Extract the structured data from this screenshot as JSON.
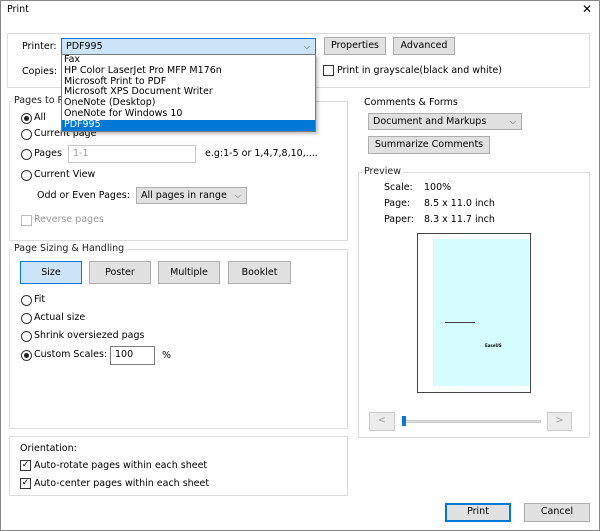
{
  "title": "Print",
  "printer": {
    "label": "Printer:",
    "value": "PDF995",
    "options": [
      "Fax",
      "HP Color LaserJet Pro MFP M176n",
      "Microsoft Print to PDF",
      "Microsoft XPS Document Writer",
      "OneNote (Desktop)",
      "OneNote for Windows 10",
      "PDF995"
    ],
    "properties": "Properties",
    "advanced": "Advanced",
    "copies_label": "Copies:",
    "grayscale": "Print in grayscale(black and white)"
  },
  "pages": {
    "title": "Pages to Print",
    "all": "All",
    "current_page": "Current page",
    "pages": "Pages",
    "pages_placeholder": "1-1",
    "example": "e.g:1-5 or 1,4,7,8,10,....",
    "current_view": "Current View",
    "odd_even_label": "Odd or Even Pages:",
    "odd_even_value": "All pages in range",
    "reverse": "Reverse pages"
  },
  "sizing": {
    "title": "Page Sizing & Handling",
    "tabs": [
      "Size",
      "Poster",
      "Multiple",
      "Booklet"
    ],
    "fit": "Fit",
    "actual": "Actual size",
    "shrink": "Shrink oversiezed pags",
    "custom": "Custom Scales:",
    "custom_value": "100",
    "percent": "%"
  },
  "orientation": {
    "title": "Orientation:",
    "auto_rotate": "Auto-rotate pages within each sheet",
    "auto_center": "Auto-center pages within each sheet"
  },
  "comments": {
    "title": "Comments & Forms",
    "value": "Document and Markups",
    "summarize": "Summarize Comments"
  },
  "preview": {
    "title": "Preview",
    "scale_label": "Scale:",
    "scale": "100%",
    "page_label": "Page:",
    "page": "8.5 x 11.0 inch",
    "paper_label": "Paper:",
    "paper": "8.3 x 11.7 inch",
    "doc_text": "EaseUS",
    "prev": "<",
    "next": ">",
    "page_color": "#d6fdfd"
  },
  "footer": {
    "print": "Print",
    "cancel": "Cancel"
  },
  "colors": {
    "accent": "#0078d7"
  }
}
